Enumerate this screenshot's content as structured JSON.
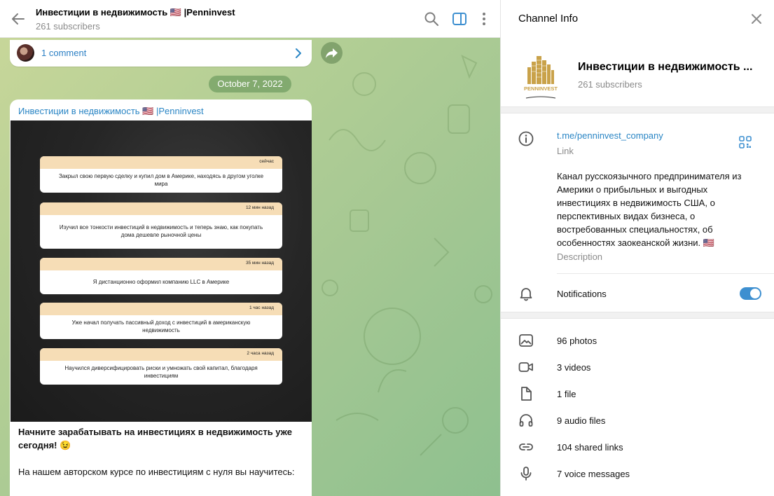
{
  "header": {
    "title": "Инвестиции в недвижимость 🇺🇸 |Penninvest",
    "subscribers": "261 subscribers"
  },
  "thread": {
    "comments": "1 comment"
  },
  "date_separator": "October 7, 2022",
  "post": {
    "author": "Инвестиции в недвижимость 🇺🇸 |Penninvest",
    "notes": [
      {
        "time": "сейчас",
        "text": "Закрыл свою первую сделку и купил дом в Америке, находясь в другом уголке мира"
      },
      {
        "time": "12 мин назад",
        "text": "Изучил все тонкости инвестиций в недвижимость и теперь знаю, как покупать дома дешевле рыночной цены"
      },
      {
        "time": "35 мин назад",
        "text": "Я дистанционно оформил компанию LLC в Америке"
      },
      {
        "time": "1 час назад",
        "text": "Уже начал получать пассивный доход с инвестиций в американскую недвижимость"
      },
      {
        "time": "2 часа назад",
        "text": "Научился диверсифицировать риски и умножать свой капитал, благодаря инвестициям"
      }
    ],
    "text_bold": "Начните зарабатывать на инвестициях в недвижимость уже сегодня! 😉",
    "text_body": "На нашем авторском курсе по инвестициям с нуля вы научитесь:"
  },
  "info": {
    "title": "Channel Info",
    "channel_name": "Инвестиции в недвижимость ...",
    "subscribers": "261 subscribers",
    "logo_text": "PENNINVEST",
    "link": "t.me/penninvest_company",
    "link_label": "Link",
    "description": "Канал русскоязычного предпринимателя из Америки о прибыльных и выгодных инвестициях в недвижимость США, о перспективных видах бизнеса, о востребованных специальностях, об особенностях заокеанской жизни. 🇺🇸",
    "description_label": "Description",
    "notifications_label": "Notifications",
    "notifications_on": true,
    "media": [
      {
        "icon": "photo-icon",
        "label": "96 photos"
      },
      {
        "icon": "video-icon",
        "label": "3 videos"
      },
      {
        "icon": "file-icon",
        "label": "1 file"
      },
      {
        "icon": "headphones-icon",
        "label": "9 audio files"
      },
      {
        "icon": "link-icon",
        "label": "104 shared links"
      },
      {
        "icon": "microphone-icon",
        "label": "7 voice messages"
      }
    ]
  },
  "colors": {
    "accent": "#3d8fd0",
    "link": "#2b86c5",
    "note_header": "#f6ddb6"
  }
}
